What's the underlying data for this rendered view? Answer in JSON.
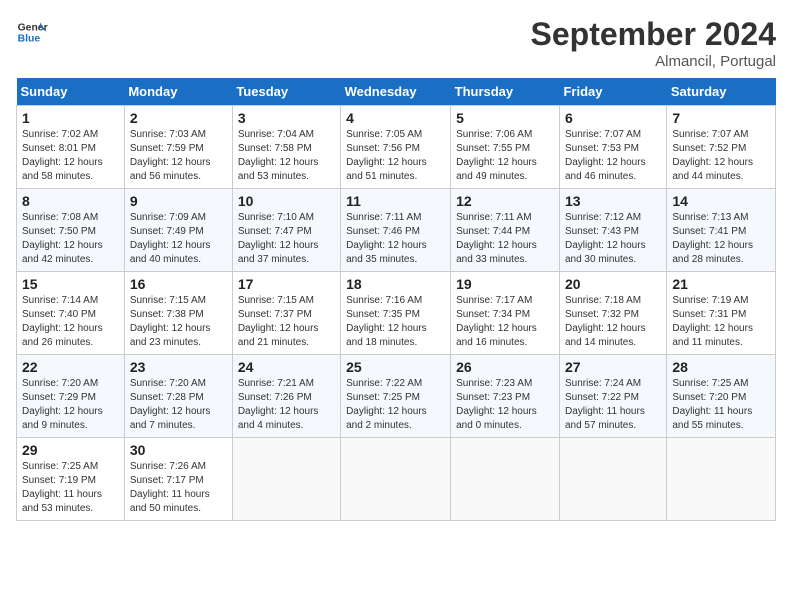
{
  "header": {
    "logo_line1": "General",
    "logo_line2": "Blue",
    "month_title": "September 2024",
    "location": "Almancil, Portugal"
  },
  "weekdays": [
    "Sunday",
    "Monday",
    "Tuesday",
    "Wednesday",
    "Thursday",
    "Friday",
    "Saturday"
  ],
  "weeks": [
    [
      {
        "day": "1",
        "sunrise": "7:02 AM",
        "sunset": "8:01 PM",
        "daylight": "12 hours and 58 minutes."
      },
      {
        "day": "2",
        "sunrise": "7:03 AM",
        "sunset": "7:59 PM",
        "daylight": "12 hours and 56 minutes."
      },
      {
        "day": "3",
        "sunrise": "7:04 AM",
        "sunset": "7:58 PM",
        "daylight": "12 hours and 53 minutes."
      },
      {
        "day": "4",
        "sunrise": "7:05 AM",
        "sunset": "7:56 PM",
        "daylight": "12 hours and 51 minutes."
      },
      {
        "day": "5",
        "sunrise": "7:06 AM",
        "sunset": "7:55 PM",
        "daylight": "12 hours and 49 minutes."
      },
      {
        "day": "6",
        "sunrise": "7:07 AM",
        "sunset": "7:53 PM",
        "daylight": "12 hours and 46 minutes."
      },
      {
        "day": "7",
        "sunrise": "7:07 AM",
        "sunset": "7:52 PM",
        "daylight": "12 hours and 44 minutes."
      }
    ],
    [
      {
        "day": "8",
        "sunrise": "7:08 AM",
        "sunset": "7:50 PM",
        "daylight": "12 hours and 42 minutes."
      },
      {
        "day": "9",
        "sunrise": "7:09 AM",
        "sunset": "7:49 PM",
        "daylight": "12 hours and 40 minutes."
      },
      {
        "day": "10",
        "sunrise": "7:10 AM",
        "sunset": "7:47 PM",
        "daylight": "12 hours and 37 minutes."
      },
      {
        "day": "11",
        "sunrise": "7:11 AM",
        "sunset": "7:46 PM",
        "daylight": "12 hours and 35 minutes."
      },
      {
        "day": "12",
        "sunrise": "7:11 AM",
        "sunset": "7:44 PM",
        "daylight": "12 hours and 33 minutes."
      },
      {
        "day": "13",
        "sunrise": "7:12 AM",
        "sunset": "7:43 PM",
        "daylight": "12 hours and 30 minutes."
      },
      {
        "day": "14",
        "sunrise": "7:13 AM",
        "sunset": "7:41 PM",
        "daylight": "12 hours and 28 minutes."
      }
    ],
    [
      {
        "day": "15",
        "sunrise": "7:14 AM",
        "sunset": "7:40 PM",
        "daylight": "12 hours and 26 minutes."
      },
      {
        "day": "16",
        "sunrise": "7:15 AM",
        "sunset": "7:38 PM",
        "daylight": "12 hours and 23 minutes."
      },
      {
        "day": "17",
        "sunrise": "7:15 AM",
        "sunset": "7:37 PM",
        "daylight": "12 hours and 21 minutes."
      },
      {
        "day": "18",
        "sunrise": "7:16 AM",
        "sunset": "7:35 PM",
        "daylight": "12 hours and 18 minutes."
      },
      {
        "day": "19",
        "sunrise": "7:17 AM",
        "sunset": "7:34 PM",
        "daylight": "12 hours and 16 minutes."
      },
      {
        "day": "20",
        "sunrise": "7:18 AM",
        "sunset": "7:32 PM",
        "daylight": "12 hours and 14 minutes."
      },
      {
        "day": "21",
        "sunrise": "7:19 AM",
        "sunset": "7:31 PM",
        "daylight": "12 hours and 11 minutes."
      }
    ],
    [
      {
        "day": "22",
        "sunrise": "7:20 AM",
        "sunset": "7:29 PM",
        "daylight": "12 hours and 9 minutes."
      },
      {
        "day": "23",
        "sunrise": "7:20 AM",
        "sunset": "7:28 PM",
        "daylight": "12 hours and 7 minutes."
      },
      {
        "day": "24",
        "sunrise": "7:21 AM",
        "sunset": "7:26 PM",
        "daylight": "12 hours and 4 minutes."
      },
      {
        "day": "25",
        "sunrise": "7:22 AM",
        "sunset": "7:25 PM",
        "daylight": "12 hours and 2 minutes."
      },
      {
        "day": "26",
        "sunrise": "7:23 AM",
        "sunset": "7:23 PM",
        "daylight": "12 hours and 0 minutes."
      },
      {
        "day": "27",
        "sunrise": "7:24 AM",
        "sunset": "7:22 PM",
        "daylight": "11 hours and 57 minutes."
      },
      {
        "day": "28",
        "sunrise": "7:25 AM",
        "sunset": "7:20 PM",
        "daylight": "11 hours and 55 minutes."
      }
    ],
    [
      {
        "day": "29",
        "sunrise": "7:25 AM",
        "sunset": "7:19 PM",
        "daylight": "11 hours and 53 minutes."
      },
      {
        "day": "30",
        "sunrise": "7:26 AM",
        "sunset": "7:17 PM",
        "daylight": "11 hours and 50 minutes."
      },
      null,
      null,
      null,
      null,
      null
    ]
  ]
}
